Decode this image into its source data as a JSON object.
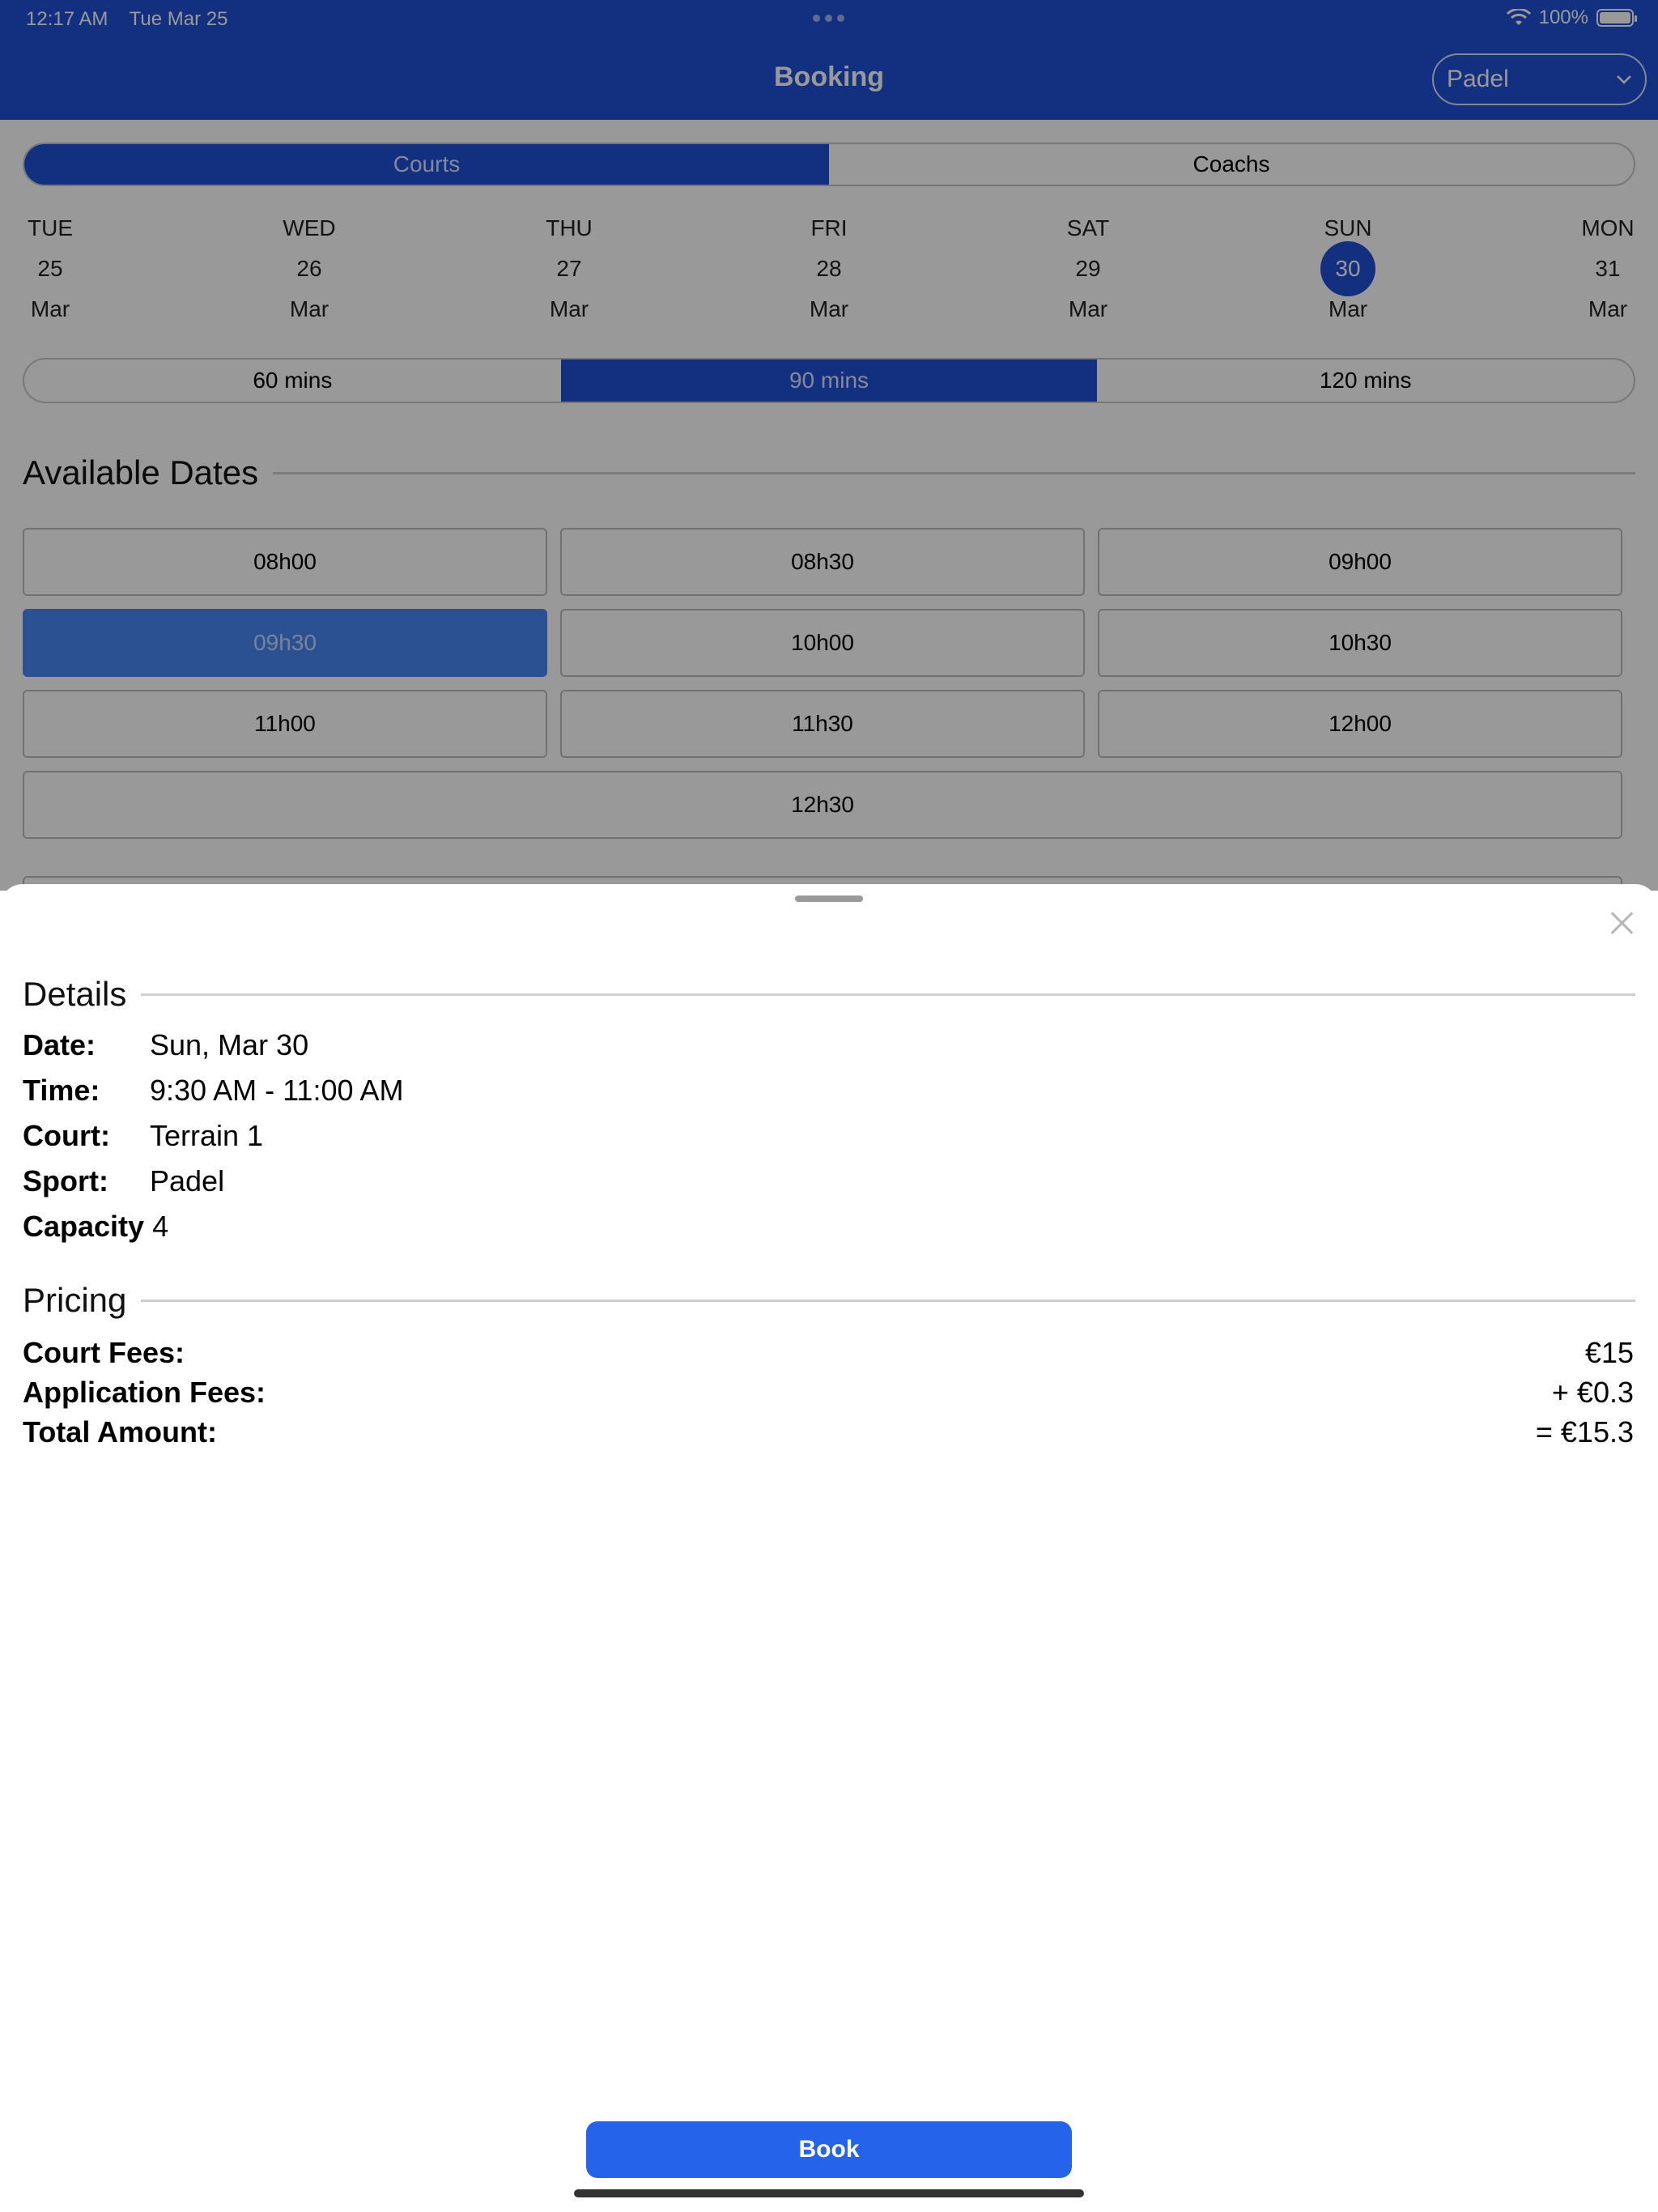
{
  "status_bar": {
    "time": "12:17 AM",
    "date": "Tue Mar 25",
    "battery_pct": "100%"
  },
  "nav": {
    "title": "Booking",
    "sport_selected": "Padel"
  },
  "tabs": [
    {
      "label": "Courts",
      "active": true
    },
    {
      "label": "Coachs",
      "active": false
    }
  ],
  "calendar": [
    {
      "dow": "TUE",
      "day": "25",
      "month": "Mar"
    },
    {
      "dow": "WED",
      "day": "26",
      "month": "Mar"
    },
    {
      "dow": "THU",
      "day": "27",
      "month": "Mar"
    },
    {
      "dow": "FRI",
      "day": "28",
      "month": "Mar"
    },
    {
      "dow": "SAT",
      "day": "29",
      "month": "Mar"
    },
    {
      "dow": "SUN",
      "day": "30",
      "month": "Mar",
      "selected": true
    },
    {
      "dow": "MON",
      "day": "31",
      "month": "Mar"
    }
  ],
  "durations": [
    {
      "label": "60 mins"
    },
    {
      "label": "90 mins",
      "active": true
    },
    {
      "label": "120 mins"
    }
  ],
  "available": {
    "heading": "Available Dates",
    "slots": [
      "08h00",
      "08h30",
      "09h00",
      "09h30",
      "10h00",
      "10h30",
      "11h00",
      "11h30",
      "12h00",
      "12h30"
    ],
    "selected_slot": "09h30"
  },
  "sheet": {
    "details_heading": "Details",
    "details": [
      {
        "key": "Date:",
        "value": "Sun, Mar 30"
      },
      {
        "key": "Time:",
        "value": "9:30 AM - 11:00 AM"
      },
      {
        "key": "Court:",
        "value": "Terrain 1"
      },
      {
        "key": "Sport:",
        "value": "Padel"
      },
      {
        "key": "Capacity",
        "value": "4"
      }
    ],
    "pricing_heading": "Pricing",
    "pricing": [
      {
        "key": "Court Fees:",
        "value": "€15"
      },
      {
        "key": "Application Fees:",
        "value": "+ €0.3"
      },
      {
        "key": "Total Amount:",
        "value": "= €15.3"
      }
    ],
    "book_label": "Book"
  },
  "colors": {
    "accent": "#1f4fd6",
    "selected_slot": "#4a87f5",
    "button": "#2563eb"
  }
}
